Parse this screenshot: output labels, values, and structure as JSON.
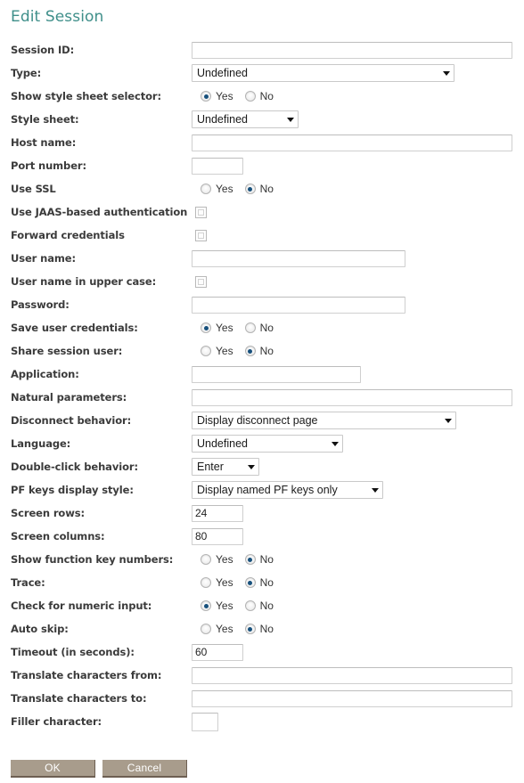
{
  "page": {
    "title": "Edit Session",
    "title_color": "#3f8f8a",
    "button_color": "#a89c8c"
  },
  "labels": {
    "session_id": "Session ID:",
    "type": "Type:",
    "show_style_sheet_selector": "Show style sheet selector:",
    "style_sheet": "Style sheet:",
    "host_name": "Host name:",
    "port_number": "Port number:",
    "use_ssl": "Use SSL",
    "use_jaas": "Use JAAS-based authentication",
    "forward_credentials": "Forward credentials",
    "user_name": "User name:",
    "user_name_upper": "User name in upper case:",
    "password": "Password:",
    "save_user_credentials": "Save user credentials:",
    "share_session_user": "Share session user:",
    "application": "Application:",
    "natural_parameters": "Natural parameters:",
    "disconnect_behavior": "Disconnect behavior:",
    "language": "Language:",
    "double_click_behavior": "Double-click behavior:",
    "pf_keys_display_style": "PF keys display style:",
    "screen_rows": "Screen rows:",
    "screen_columns": "Screen columns:",
    "show_function_key_numbers": "Show function key numbers:",
    "trace": "Trace:",
    "check_numeric_input": "Check for numeric input:",
    "auto_skip": "Auto skip:",
    "timeout": "Timeout (in seconds):",
    "translate_from": "Translate characters from:",
    "translate_to": "Translate characters to:",
    "filler_character": "Filler character:"
  },
  "values": {
    "session_id": "",
    "type": "Undefined",
    "show_style_sheet_selector": "Yes",
    "style_sheet": "Undefined",
    "host_name": "",
    "port_number": "",
    "use_ssl": "No",
    "use_jaas": false,
    "forward_credentials": false,
    "user_name": "",
    "user_name_upper": false,
    "password": "",
    "save_user_credentials": "Yes",
    "share_session_user": "No",
    "application": "",
    "natural_parameters": "",
    "disconnect_behavior": "Display disconnect page",
    "language": "Undefined",
    "double_click_behavior": "Enter",
    "pf_keys_display_style": "Display named PF keys only",
    "screen_rows": "24",
    "screen_columns": "80",
    "show_function_key_numbers": "No",
    "trace": "No",
    "check_numeric_input": "Yes",
    "auto_skip": "No",
    "timeout": "60",
    "translate_from": "",
    "translate_to": "",
    "filler_character": ""
  },
  "radio_options": {
    "yes": "Yes",
    "no": "No"
  },
  "buttons": {
    "ok": "OK",
    "cancel": "Cancel"
  }
}
